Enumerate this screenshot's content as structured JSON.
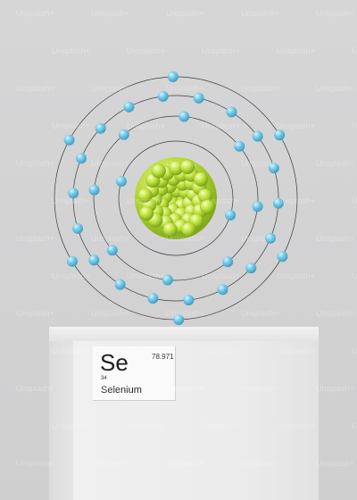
{
  "element_tile": {
    "symbol": "Se",
    "atomic_mass": "78.971",
    "atomic_number": "34",
    "name": "Selenium"
  },
  "watermark": {
    "text": "Unsplash+"
  },
  "atom_model": {
    "electron_shells": [
      2,
      8,
      18,
      6
    ],
    "nucleus_color": "#a6cc2e",
    "electron_color": "#6cc6e3",
    "orbit_color": "#3c3c3c"
  },
  "colors": {
    "background": "#d4d4d5",
    "plinth": "#ececec"
  }
}
